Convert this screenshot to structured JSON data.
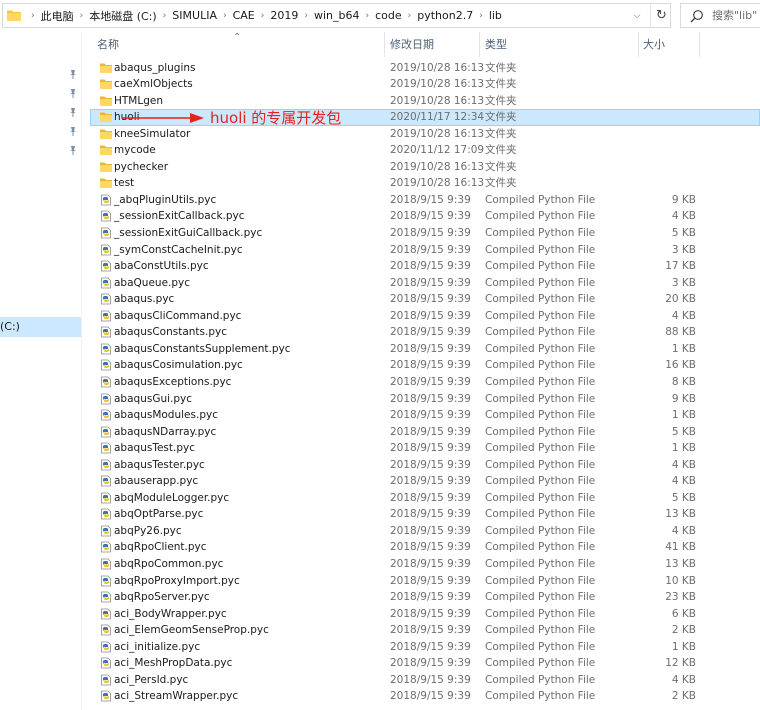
{
  "address_bar": {
    "breadcrumbs": [
      "此电脑",
      "本地磁盘 (C:)",
      "SIMULIA",
      "CAE",
      "2019",
      "win_b64",
      "code",
      "python2.7",
      "lib"
    ],
    "dropdown_icon": "chevron-down-icon",
    "refresh_icon": "refresh-icon"
  },
  "search": {
    "placeholder": "搜索\"lib\""
  },
  "nav": {
    "selected_label": "(C:)"
  },
  "columns": {
    "name": "名称",
    "date": "修改日期",
    "type": "类型",
    "size": "大小"
  },
  "annotation": {
    "text": "huoli 的专属开发包",
    "color": "#e8211c"
  },
  "colors": {
    "folder": "#f5c842",
    "selection": "#cce8ff",
    "header_text": "#4c607a"
  },
  "files": [
    {
      "name": "abaqus_plugins",
      "date": "2019/10/28 16:13",
      "type": "文件夹",
      "size": "",
      "kind": "folder"
    },
    {
      "name": "caeXmlObjects",
      "date": "2019/10/28 16:13",
      "type": "文件夹",
      "size": "",
      "kind": "folder"
    },
    {
      "name": "HTMLgen",
      "date": "2019/10/28 16:13",
      "type": "文件夹",
      "size": "",
      "kind": "folder"
    },
    {
      "name": "huoli",
      "date": "2020/11/17 12:34",
      "type": "文件夹",
      "size": "",
      "kind": "folder",
      "selected": true
    },
    {
      "name": "kneeSimulator",
      "date": "2019/10/28 16:13",
      "type": "文件夹",
      "size": "",
      "kind": "folder"
    },
    {
      "name": "mycode",
      "date": "2020/11/12 17:09",
      "type": "文件夹",
      "size": "",
      "kind": "folder"
    },
    {
      "name": "pychecker",
      "date": "2019/10/28 16:13",
      "type": "文件夹",
      "size": "",
      "kind": "folder"
    },
    {
      "name": "test",
      "date": "2019/10/28 16:13",
      "type": "文件夹",
      "size": "",
      "kind": "folder"
    },
    {
      "name": "_abqPluginUtils.pyc",
      "date": "2018/9/15 9:39",
      "type": "Compiled Python File",
      "size": "9 KB",
      "kind": "pyc"
    },
    {
      "name": "_sessionExitCallback.pyc",
      "date": "2018/9/15 9:39",
      "type": "Compiled Python File",
      "size": "4 KB",
      "kind": "pyc"
    },
    {
      "name": "_sessionExitGuiCallback.pyc",
      "date": "2018/9/15 9:39",
      "type": "Compiled Python File",
      "size": "5 KB",
      "kind": "pyc"
    },
    {
      "name": "_symConstCacheInit.pyc",
      "date": "2018/9/15 9:39",
      "type": "Compiled Python File",
      "size": "3 KB",
      "kind": "pyc"
    },
    {
      "name": "abaConstUtils.pyc",
      "date": "2018/9/15 9:39",
      "type": "Compiled Python File",
      "size": "17 KB",
      "kind": "pyc"
    },
    {
      "name": "abaQueue.pyc",
      "date": "2018/9/15 9:39",
      "type": "Compiled Python File",
      "size": "3 KB",
      "kind": "pyc"
    },
    {
      "name": "abaqus.pyc",
      "date": "2018/9/15 9:39",
      "type": "Compiled Python File",
      "size": "20 KB",
      "kind": "pyc"
    },
    {
      "name": "abaqusCliCommand.pyc",
      "date": "2018/9/15 9:39",
      "type": "Compiled Python File",
      "size": "4 KB",
      "kind": "pyc"
    },
    {
      "name": "abaqusConstants.pyc",
      "date": "2018/9/15 9:39",
      "type": "Compiled Python File",
      "size": "88 KB",
      "kind": "pyc"
    },
    {
      "name": "abaqusConstantsSupplement.pyc",
      "date": "2018/9/15 9:39",
      "type": "Compiled Python File",
      "size": "1 KB",
      "kind": "pyc"
    },
    {
      "name": "abaqusCosimulation.pyc",
      "date": "2018/9/15 9:39",
      "type": "Compiled Python File",
      "size": "16 KB",
      "kind": "pyc"
    },
    {
      "name": "abaqusExceptions.pyc",
      "date": "2018/9/15 9:39",
      "type": "Compiled Python File",
      "size": "8 KB",
      "kind": "pyc"
    },
    {
      "name": "abaqusGui.pyc",
      "date": "2018/9/15 9:39",
      "type": "Compiled Python File",
      "size": "9 KB",
      "kind": "pyc"
    },
    {
      "name": "abaqusModules.pyc",
      "date": "2018/9/15 9:39",
      "type": "Compiled Python File",
      "size": "1 KB",
      "kind": "pyc"
    },
    {
      "name": "abaqusNDarray.pyc",
      "date": "2018/9/15 9:39",
      "type": "Compiled Python File",
      "size": "5 KB",
      "kind": "pyc"
    },
    {
      "name": "abaqusTest.pyc",
      "date": "2018/9/15 9:39",
      "type": "Compiled Python File",
      "size": "1 KB",
      "kind": "pyc"
    },
    {
      "name": "abaqusTester.pyc",
      "date": "2018/9/15 9:39",
      "type": "Compiled Python File",
      "size": "4 KB",
      "kind": "pyc"
    },
    {
      "name": "abauserapp.pyc",
      "date": "2018/9/15 9:39",
      "type": "Compiled Python File",
      "size": "4 KB",
      "kind": "pyc"
    },
    {
      "name": "abqModuleLogger.pyc",
      "date": "2018/9/15 9:39",
      "type": "Compiled Python File",
      "size": "5 KB",
      "kind": "pyc"
    },
    {
      "name": "abqOptParse.pyc",
      "date": "2018/9/15 9:39",
      "type": "Compiled Python File",
      "size": "13 KB",
      "kind": "pyc"
    },
    {
      "name": "abqPy26.pyc",
      "date": "2018/9/15 9:39",
      "type": "Compiled Python File",
      "size": "4 KB",
      "kind": "pyc"
    },
    {
      "name": "abqRpoClient.pyc",
      "date": "2018/9/15 9:39",
      "type": "Compiled Python File",
      "size": "41 KB",
      "kind": "pyc"
    },
    {
      "name": "abqRpoCommon.pyc",
      "date": "2018/9/15 9:39",
      "type": "Compiled Python File",
      "size": "13 KB",
      "kind": "pyc"
    },
    {
      "name": "abqRpoProxyImport.pyc",
      "date": "2018/9/15 9:39",
      "type": "Compiled Python File",
      "size": "10 KB",
      "kind": "pyc"
    },
    {
      "name": "abqRpoServer.pyc",
      "date": "2018/9/15 9:39",
      "type": "Compiled Python File",
      "size": "23 KB",
      "kind": "pyc"
    },
    {
      "name": "aci_BodyWrapper.pyc",
      "date": "2018/9/15 9:39",
      "type": "Compiled Python File",
      "size": "6 KB",
      "kind": "pyc"
    },
    {
      "name": "aci_ElemGeomSenseProp.pyc",
      "date": "2018/9/15 9:39",
      "type": "Compiled Python File",
      "size": "2 KB",
      "kind": "pyc"
    },
    {
      "name": "aci_initialize.pyc",
      "date": "2018/9/15 9:39",
      "type": "Compiled Python File",
      "size": "1 KB",
      "kind": "pyc"
    },
    {
      "name": "aci_MeshPropData.pyc",
      "date": "2018/9/15 9:39",
      "type": "Compiled Python File",
      "size": "12 KB",
      "kind": "pyc"
    },
    {
      "name": "aci_PersId.pyc",
      "date": "2018/9/15 9:39",
      "type": "Compiled Python File",
      "size": "4 KB",
      "kind": "pyc"
    },
    {
      "name": "aci_StreamWrapper.pyc",
      "date": "2018/9/15 9:39",
      "type": "Compiled Python File",
      "size": "2 KB",
      "kind": "pyc"
    }
  ]
}
